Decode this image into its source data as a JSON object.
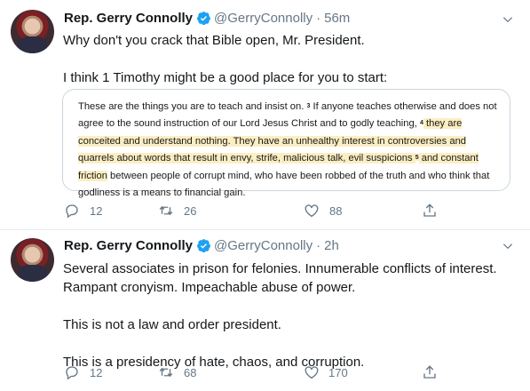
{
  "tweets": [
    {
      "name": "Rep. Gerry Connolly",
      "handle": "@GerryConnolly",
      "separator": "·",
      "time": "56m",
      "text_lines": [
        "Why don't you crack that Bible open, Mr. President.",
        "I think 1 Timothy might be a good place for you to start:"
      ],
      "card": {
        "segments": [
          {
            "t": "These are the things you are to teach and insist on. ",
            "hl": false
          },
          {
            "t": "3",
            "sup": true
          },
          {
            "t": " If anyone teaches otherwise and does not agree to the sound instruction of our Lord Jesus Christ and to godly teaching, ",
            "hl": false
          },
          {
            "t": "4",
            "sup": true
          },
          {
            "t": " they are conceited and understand nothing. They have an unhealthy interest in controversies and quarrels about words that result in envy, strife, malicious talk, evil suspicions ",
            "hl": true
          },
          {
            "t": "5",
            "sup": true,
            "hl": true
          },
          {
            "t": " and constant friction",
            "hl": true
          },
          {
            "t": " between people of corrupt mind, who have been robbed of the truth and who think that godliness is a means to financial gain.",
            "hl": false
          }
        ]
      },
      "replies": "12",
      "retweets": "26",
      "likes": "88"
    },
    {
      "name": "Rep. Gerry Connolly",
      "handle": "@GerryConnolly",
      "separator": "·",
      "time": "2h",
      "text_lines": [
        "Several associates in prison for felonies. Innumerable conflicts of interest. Rampant cronyism. Impeachable abuse of power.",
        "This is not a law and order president.",
        "This is a presidency of hate, chaos, and corruption."
      ],
      "replies": "12",
      "retweets": "68",
      "likes": "170"
    }
  ],
  "icons": {
    "verified": "verified-badge-icon",
    "menu": "chevron-down-icon",
    "reply": "reply-icon",
    "retweet": "retweet-icon",
    "like": "heart-icon",
    "share": "share-icon"
  },
  "colors": {
    "verified": "#1da1f2",
    "muted": "#657786",
    "highlight": "#fbeec2",
    "border": "#e6ecf0"
  }
}
